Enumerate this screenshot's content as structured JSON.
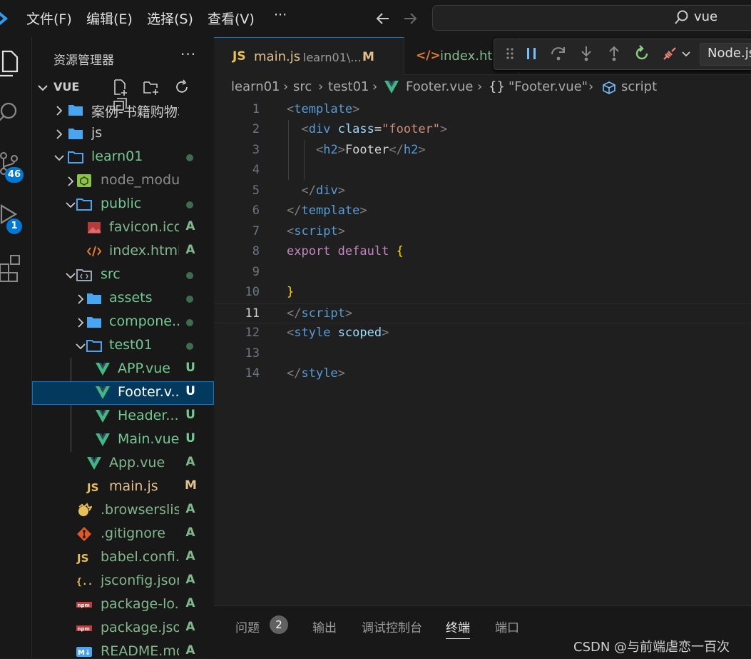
{
  "menu": {
    "file": "文件(F)",
    "edit": "编辑(E)",
    "selection": "选择(S)",
    "view": "查看(V)",
    "more": "···"
  },
  "search": {
    "text": "vue"
  },
  "activity": {
    "scm_badge": "46",
    "debug_badge": "1"
  },
  "explorer": {
    "title": "资源管理器",
    "more": "···",
    "section": "VUE",
    "tree": [
      {
        "label": "案例-书籍购物车",
        "depth": 0,
        "kind": "folder",
        "chev": ">",
        "status": ""
      },
      {
        "label": "js",
        "depth": 0,
        "kind": "folder",
        "chev": ">",
        "status": ""
      },
      {
        "label": "learn01",
        "depth": 0,
        "kind": "folder-open",
        "chev": "v",
        "status": "dot"
      },
      {
        "label": "node_modules",
        "depth": 1,
        "kind": "node",
        "chev": ">",
        "status": ""
      },
      {
        "label": "public",
        "depth": 1,
        "kind": "folder-open",
        "chev": "v",
        "status": "dot"
      },
      {
        "label": "favicon.ico",
        "depth": 2,
        "kind": "image",
        "chev": "",
        "status": "A"
      },
      {
        "label": "index.html",
        "depth": 2,
        "kind": "html",
        "chev": "",
        "status": "A"
      },
      {
        "label": "src",
        "depth": 1,
        "kind": "src",
        "chev": "v",
        "status": "dot"
      },
      {
        "label": "assets",
        "depth": 2,
        "kind": "folder",
        "chev": ">",
        "status": "dot"
      },
      {
        "label": "compone...",
        "depth": 2,
        "kind": "folder",
        "chev": ">",
        "status": "dot"
      },
      {
        "label": "test01",
        "depth": 2,
        "kind": "folder-open",
        "chev": "v",
        "status": "dot"
      },
      {
        "label": "APP.vue",
        "depth": 3,
        "kind": "vue",
        "chev": "",
        "status": "U"
      },
      {
        "label": "Footer.v...",
        "depth": 3,
        "kind": "vue",
        "chev": "",
        "status": "U",
        "selected": true
      },
      {
        "label": "Header....",
        "depth": 3,
        "kind": "vue",
        "chev": "",
        "status": "U"
      },
      {
        "label": "Main.vue",
        "depth": 3,
        "kind": "vue",
        "chev": "",
        "status": "U"
      },
      {
        "label": "App.vue",
        "depth": 2,
        "kind": "vue",
        "chev": "",
        "status": "A"
      },
      {
        "label": "main.js",
        "depth": 2,
        "kind": "js",
        "chev": "",
        "status": "M"
      },
      {
        "label": ".browserslis...",
        "depth": 1,
        "kind": "browserslist",
        "chev": "",
        "status": "A"
      },
      {
        "label": ".gitignore",
        "depth": 1,
        "kind": "git",
        "chev": "",
        "status": "A"
      },
      {
        "label": "babel.confi...",
        "depth": 1,
        "kind": "js",
        "chev": "",
        "status": "A"
      },
      {
        "label": "jsconfig.json",
        "depth": 1,
        "kind": "json",
        "chev": "",
        "status": "A"
      },
      {
        "label": "package-lo...",
        "depth": 1,
        "kind": "npm",
        "chev": "",
        "status": "A"
      },
      {
        "label": "package.json",
        "depth": 1,
        "kind": "npm",
        "chev": "",
        "status": "A"
      },
      {
        "label": "README.md",
        "depth": 1,
        "kind": "md",
        "chev": "",
        "status": "A"
      }
    ]
  },
  "tabs": [
    {
      "icon_text": "JS",
      "name": "main.js",
      "desc": "learn01\\...",
      "mod": "M"
    },
    {
      "icon_text": "</>",
      "name": "index.html"
    }
  ],
  "debug": {
    "config": "Node.js"
  },
  "breadcrumb": {
    "items": [
      "learn01",
      "src",
      "test01",
      "Footer.vue",
      "\"Footer.vue\"",
      "script"
    ],
    "obj_icon": "{}"
  },
  "code": {
    "active_line": 11,
    "line_numbers": [
      "1",
      "2",
      "3",
      "4",
      "5",
      "6",
      "7",
      "8",
      "9",
      "10",
      "11",
      "12",
      "13",
      "14"
    ]
  },
  "panel": {
    "tabs": [
      "问题",
      "输出",
      "调试控制台",
      "终端",
      "端口"
    ],
    "problems_count": "2",
    "active": "终端"
  },
  "watermark": "CSDN @与前端虐恋一百次",
  "colors": {
    "accent": "#0078d4",
    "untracked": "#73c991",
    "added": "#81b88b",
    "modified": "#e2c08d",
    "vue": "#41b883",
    "folder": "#4aa5f0"
  }
}
